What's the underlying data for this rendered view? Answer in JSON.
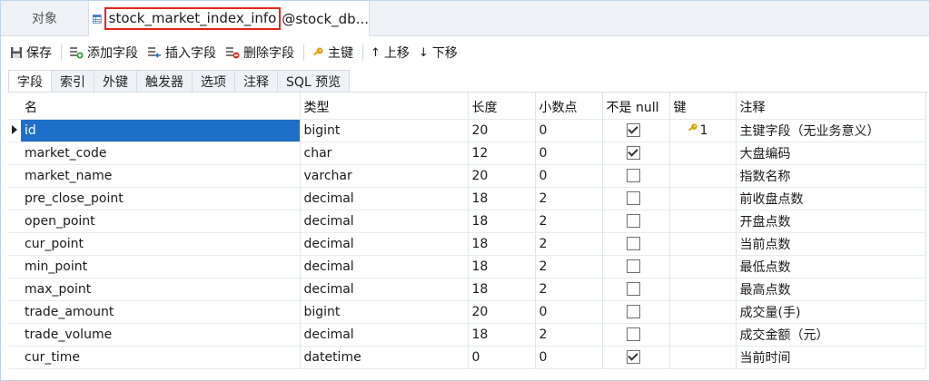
{
  "tabs": {
    "objects_label": "对象",
    "active_table_name": "stock_market_index_info",
    "active_db_suffix": "@stock_db..."
  },
  "toolbar": {
    "save": "保存",
    "add_field": "添加字段",
    "insert_field": "插入字段",
    "delete_field": "删除字段",
    "primary_key": "主键",
    "move_up": "上移",
    "move_down": "下移"
  },
  "subtabs": [
    "字段",
    "索引",
    "外键",
    "触发器",
    "选项",
    "注释",
    "SQL 预览"
  ],
  "columns": [
    "名",
    "类型",
    "长度",
    "小数点",
    "不是 null",
    "键",
    "注释"
  ],
  "rows": [
    {
      "name": "id",
      "type": "bigint",
      "length": "20",
      "decimals": "0",
      "not_null": true,
      "key": "1",
      "comment": "主键字段（无业务意义）"
    },
    {
      "name": "market_code",
      "type": "char",
      "length": "12",
      "decimals": "0",
      "not_null": true,
      "key": "",
      "comment": "大盘编码"
    },
    {
      "name": "market_name",
      "type": "varchar",
      "length": "20",
      "decimals": "0",
      "not_null": false,
      "key": "",
      "comment": "指数名称"
    },
    {
      "name": "pre_close_point",
      "type": "decimal",
      "length": "18",
      "decimals": "2",
      "not_null": false,
      "key": "",
      "comment": "前收盘点数"
    },
    {
      "name": "open_point",
      "type": "decimal",
      "length": "18",
      "decimals": "2",
      "not_null": false,
      "key": "",
      "comment": "开盘点数"
    },
    {
      "name": "cur_point",
      "type": "decimal",
      "length": "18",
      "decimals": "2",
      "not_null": false,
      "key": "",
      "comment": "当前点数"
    },
    {
      "name": "min_point",
      "type": "decimal",
      "length": "18",
      "decimals": "2",
      "not_null": false,
      "key": "",
      "comment": "最低点数"
    },
    {
      "name": "max_point",
      "type": "decimal",
      "length": "18",
      "decimals": "2",
      "not_null": false,
      "key": "",
      "comment": "最高点数"
    },
    {
      "name": "trade_amount",
      "type": "bigint",
      "length": "20",
      "decimals": "0",
      "not_null": false,
      "key": "",
      "comment": "成交量(手)"
    },
    {
      "name": "trade_volume",
      "type": "decimal",
      "length": "18",
      "decimals": "2",
      "not_null": false,
      "key": "",
      "comment": "成交金额（元）"
    },
    {
      "name": "cur_time",
      "type": "datetime",
      "length": "0",
      "decimals": "0",
      "not_null": true,
      "key": "",
      "comment": "当前时间"
    }
  ],
  "selected_row": 0,
  "colors": {
    "selection": "#1e6fc8",
    "highlight_border": "#e0261f",
    "key_icon": "#d9a400"
  }
}
